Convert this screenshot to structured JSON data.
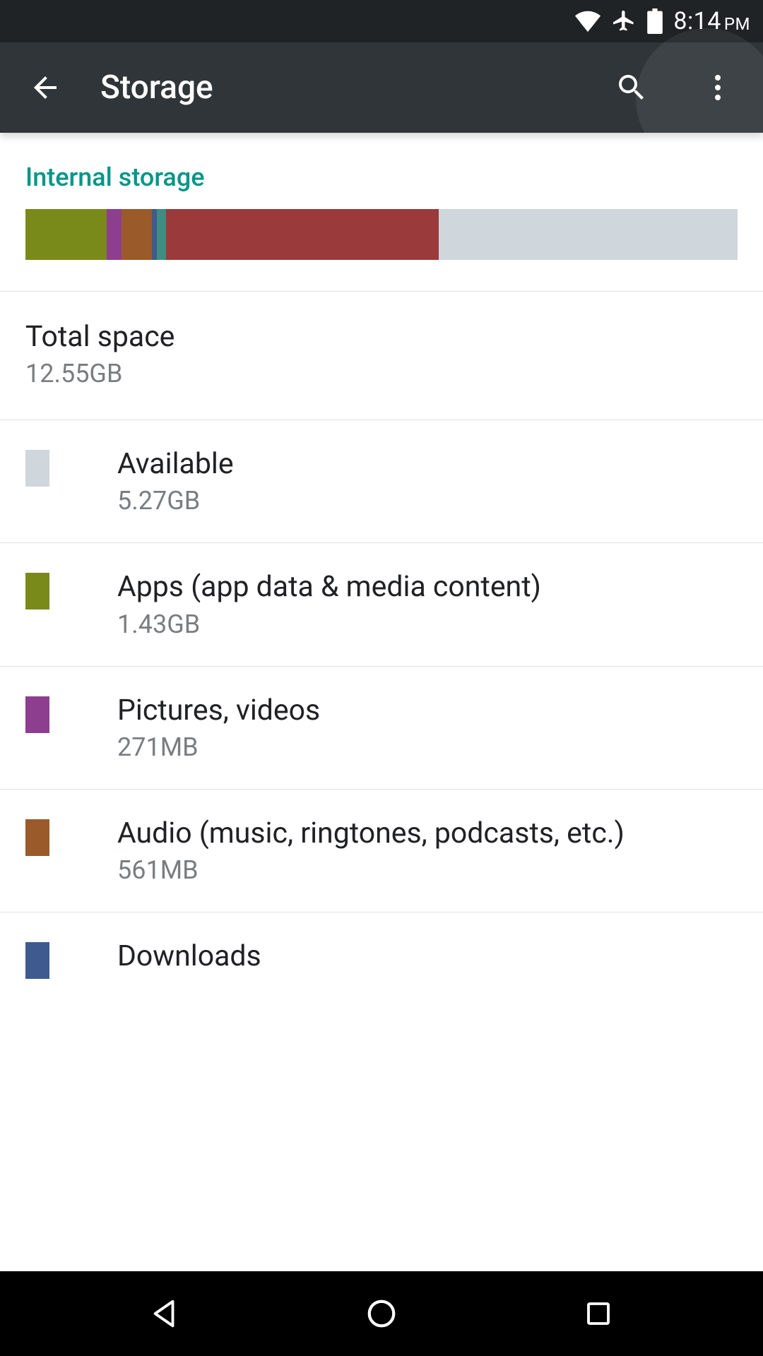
{
  "statusbar": {
    "time": "8:14",
    "ampm": "PM"
  },
  "appbar": {
    "title": "Storage"
  },
  "section": {
    "header": "Internal storage"
  },
  "bar": {
    "segments": [
      {
        "name": "apps",
        "color": "#7a8a1a",
        "percent": 11.4
      },
      {
        "name": "pictures",
        "color": "#8e3e8f",
        "percent": 2.1
      },
      {
        "name": "audio",
        "color": "#9a5a2a",
        "percent": 4.3
      },
      {
        "name": "downloads",
        "color": "#3f5a8f",
        "percent": 0.7
      },
      {
        "name": "cached",
        "color": "#3f8d82",
        "percent": 1.2
      },
      {
        "name": "other",
        "color": "#9b3a3a",
        "percent": 38.3
      }
    ]
  },
  "colors": {
    "available": "#cfd6dc",
    "apps": "#7a8a1a",
    "pictures": "#8e3e8f",
    "audio": "#9a5a2a",
    "downloads": "#3f5a8f"
  },
  "total": {
    "label": "Total space",
    "value": "12.55GB"
  },
  "items": [
    {
      "key": "available",
      "label": "Available",
      "value": "5.27GB"
    },
    {
      "key": "apps",
      "label": "Apps (app data & media content)",
      "value": "1.43GB"
    },
    {
      "key": "pictures",
      "label": "Pictures, videos",
      "value": "271MB"
    },
    {
      "key": "audio",
      "label": "Audio (music, ringtones, podcasts, etc.)",
      "value": "561MB"
    },
    {
      "key": "downloads",
      "label": "Downloads",
      "value": ""
    }
  ],
  "chart_data": {
    "type": "bar",
    "title": "Internal storage usage",
    "total_gb": 12.55,
    "series": [
      {
        "name": "Apps (app data & media content)",
        "value_gb": 1.43
      },
      {
        "name": "Pictures, videos",
        "value_mb": 271
      },
      {
        "name": "Audio (music, ringtones, podcasts, etc.)",
        "value_mb": 561
      },
      {
        "name": "Available",
        "value_gb": 5.27
      }
    ]
  }
}
